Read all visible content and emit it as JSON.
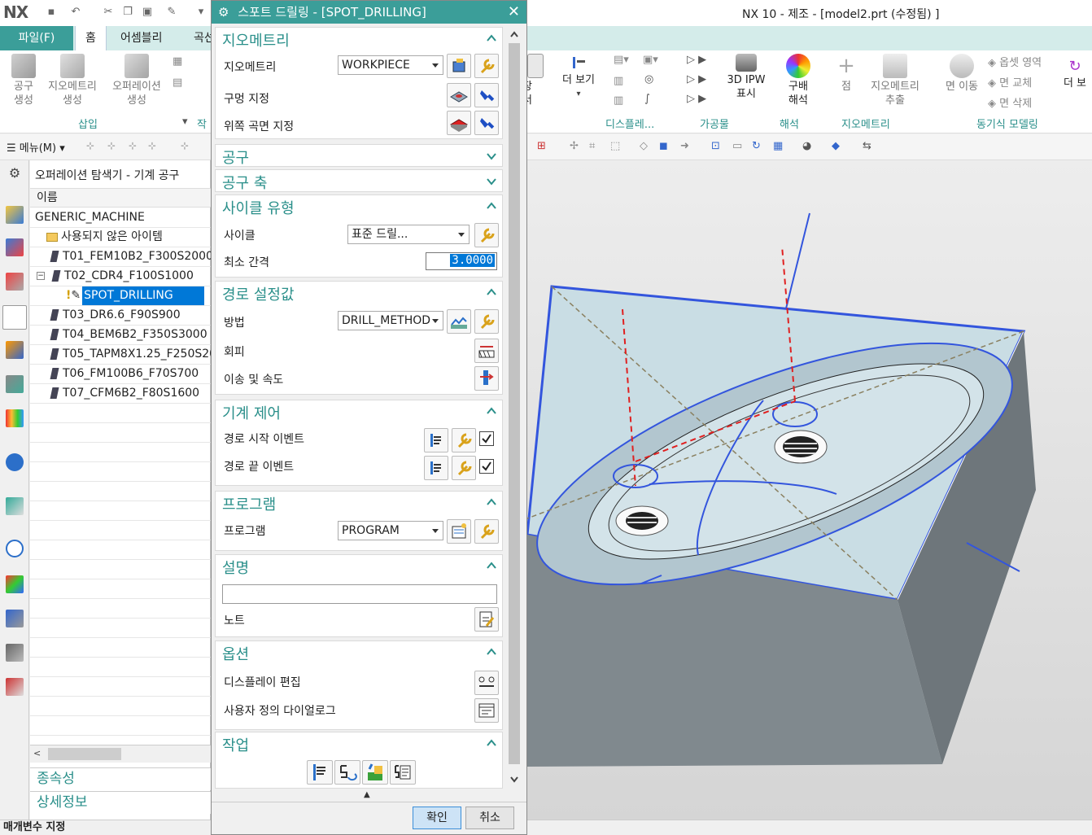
{
  "app": {
    "logo": "NX",
    "title": "NX 10 - 제조 - [model2.prt (수정됨) ]"
  },
  "ribbon": {
    "file_tab": "파일(F)",
    "tabs": [
      "홈",
      "어셈블리",
      "곡선"
    ],
    "left_buttons": [
      "공구\n생성",
      "지오메트리\n생성",
      "오퍼레이션\n생성"
    ],
    "group_insert": "삽입",
    "group_partial": "작",
    "right_buttons": {
      "shop_doc": "업장\n문서",
      "more_view": "더 보기",
      "ipw": "3D IPW\n표시",
      "gradient": "구배\n해석",
      "point": "점",
      "geom_extract": "지오메트리\n추출",
      "face_move": "면 이동",
      "offset_region": "옵셋 영역",
      "replace_face": "면 교체",
      "delete_face": "면 삭제",
      "more": "더 보"
    },
    "groups": {
      "display": "디스플레...",
      "workpiece": "가공물",
      "analysis": "해석",
      "geometry": "지오메트리",
      "sync": "동기식 모델링"
    }
  },
  "toolbar": {
    "menu": "메뉴(M)"
  },
  "navigator": {
    "title": "오퍼레이션 탐색기 - 기계 공구",
    "column": "이름",
    "rows": [
      "GENERIC_MACHINE",
      "사용되지 않은 아이템",
      "T01_FEM10B2_F300S2000",
      "T02_CDR4_F100S1000",
      "SPOT_DRILLING",
      "T03_DR6.6_F90S900",
      "T04_BEM6B2_F350S3000",
      "T05_TAPM8X1.25_F250S200",
      "T06_FM100B6_F70S700",
      "T07_CFM6B2_F80S1600"
    ],
    "sections": [
      "종속성",
      "상세정보"
    ]
  },
  "status": "매개변수 지정",
  "dialog": {
    "title": "스포트 드릴링 - [SPOT_DRILLING]",
    "geometry": {
      "header": "지오메트리",
      "geometry_label": "지오메트리",
      "geometry_value": "WORKPIECE",
      "hole_label": "구멍 지정",
      "top_surface_label": "위쪽 곡면 지정"
    },
    "tool": {
      "header": "공구"
    },
    "tool_axis": {
      "header": "공구 축"
    },
    "cycle_type": {
      "header": "사이클 유형",
      "cycle_label": "사이클",
      "cycle_value": "표준 드릴...",
      "min_clearance_label": "최소 간격",
      "min_clearance_value": "3.0000"
    },
    "path_settings": {
      "header": "경로 설정값",
      "method_label": "방법",
      "method_value": "DRILL_METHOD",
      "avoid_label": "회피",
      "feeds_label": "이송 및 속도"
    },
    "machine_control": {
      "header": "기계 제어",
      "start_event_label": "경로 시작 이벤트",
      "end_event_label": "경로 끝 이벤트"
    },
    "program": {
      "header": "프로그램",
      "program_label": "프로그램",
      "program_value": "PROGRAM"
    },
    "description": {
      "header": "설명",
      "text_value": "",
      "note_label": "노트"
    },
    "options": {
      "header": "옵션",
      "edit_display_label": "디스플레이 편집",
      "custom_dialog_label": "사용자 정의 다이얼로그"
    },
    "actions": {
      "header": "작업"
    },
    "ok": "확인",
    "cancel": "취소"
  },
  "colors": {
    "accent": "#3b9e99",
    "accent_text": "#2a8f8a",
    "selection": "#0078d7",
    "model_top": "#c9dde4",
    "model_side": "#6e767b",
    "edge": "#3355dd",
    "toolpath": "#e02020"
  }
}
